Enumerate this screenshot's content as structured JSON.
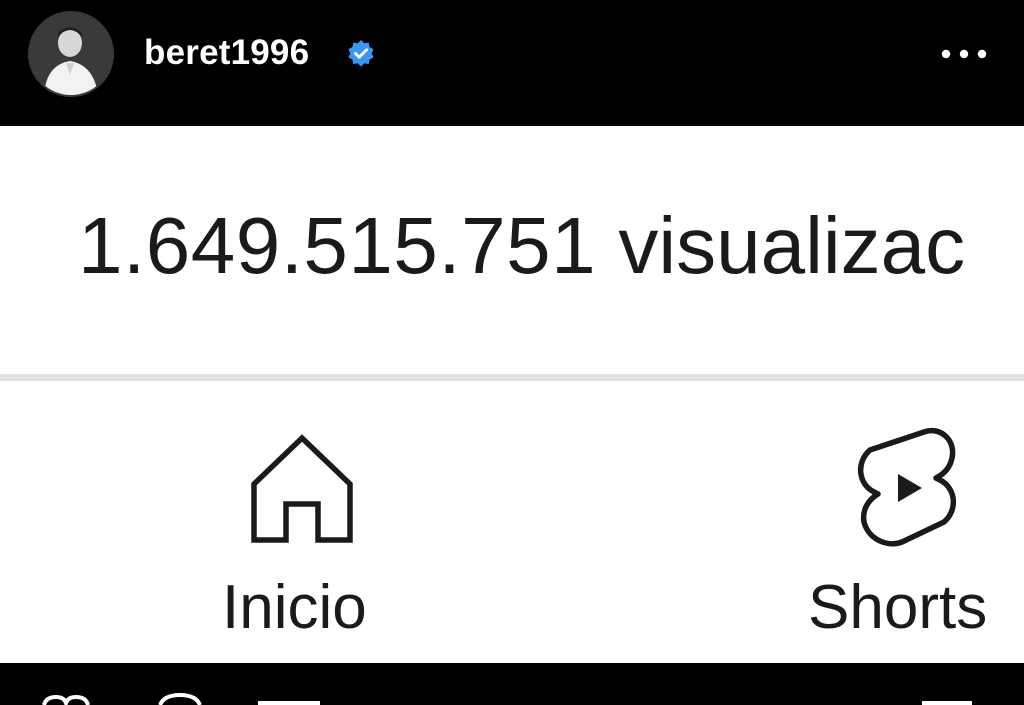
{
  "story_header": {
    "username": "beret1996",
    "verified": true,
    "verified_color": "#3897F0",
    "avatar_icon": "profile-photo",
    "more_icon": "more-horizontal-icon"
  },
  "screenshot": {
    "views_count": "1.649.515.751",
    "views_label": "visualizac",
    "nav": [
      {
        "label": "Inicio",
        "icon": "home-icon"
      },
      {
        "label": "Shorts",
        "icon": "shorts-icon"
      }
    ]
  },
  "colors": {
    "background": "#000000",
    "panel": "#FFFFFF",
    "text_dark": "#1A1A1A",
    "divider": "#E2E2E2"
  }
}
